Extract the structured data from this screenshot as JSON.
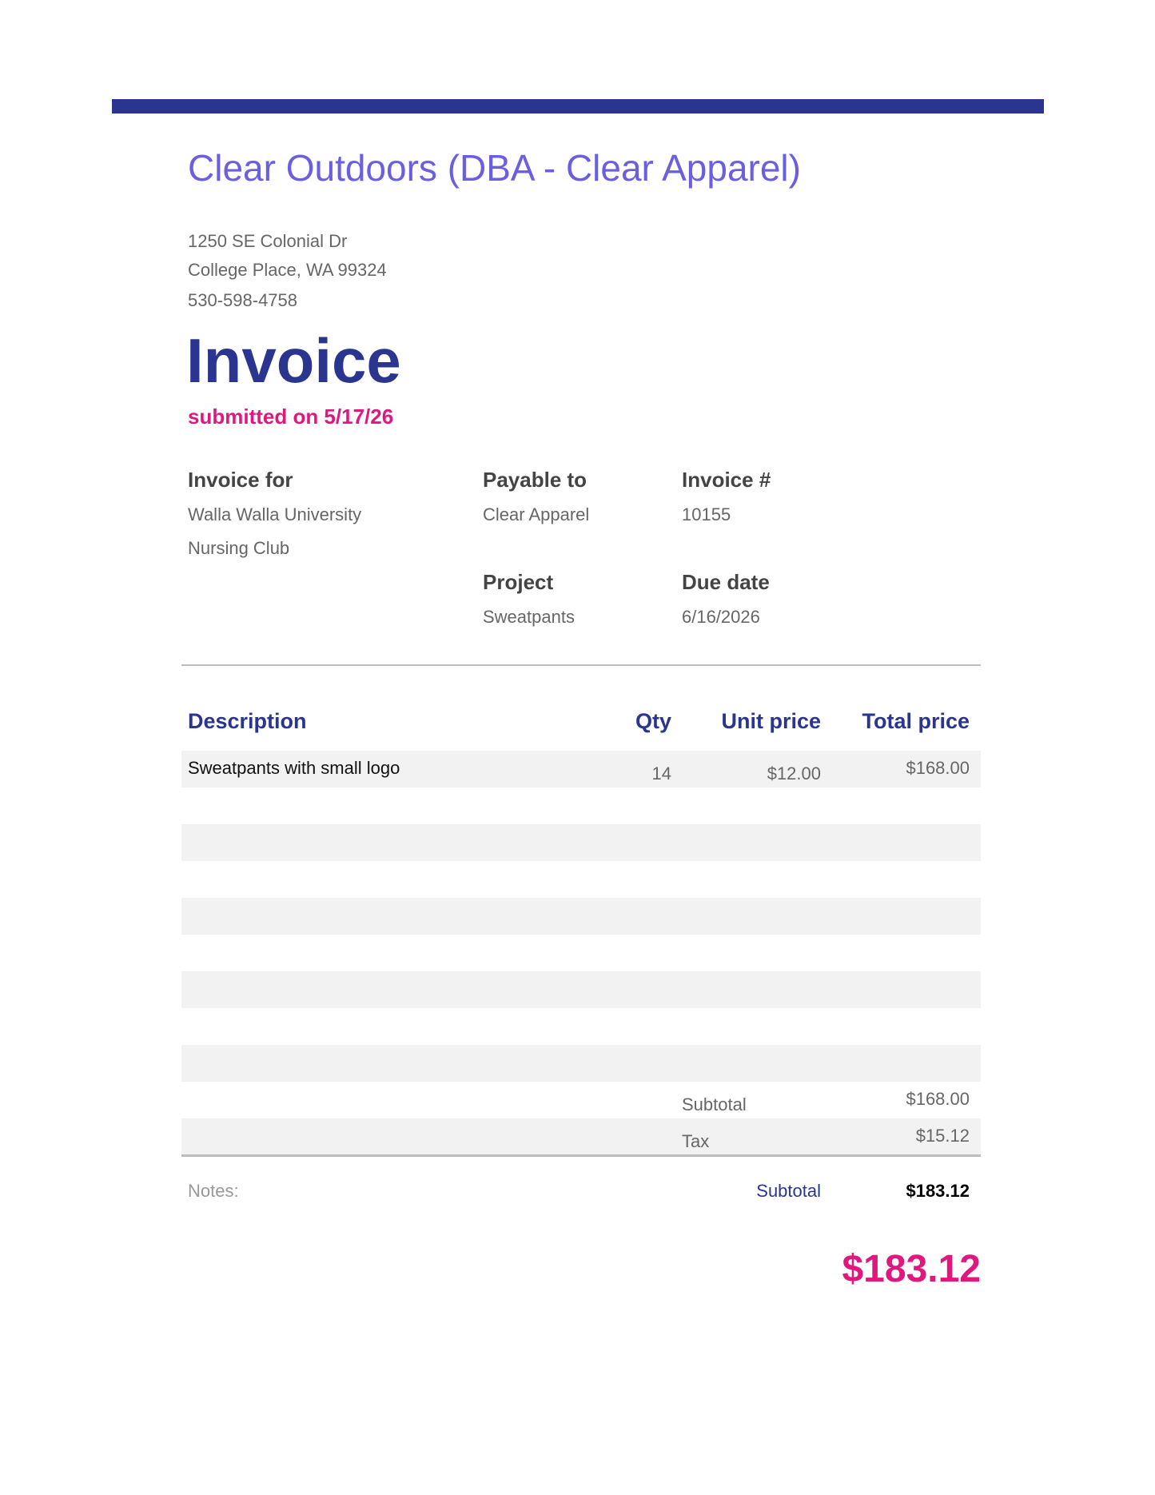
{
  "header": {
    "company_name": "Clear Outdoors (DBA - Clear Apparel)",
    "address_line1": "1250 SE Colonial Dr",
    "address_line2": "College Place, WA 99324",
    "phone": "530-598-4758",
    "accent_color": "#2a3590"
  },
  "title": {
    "heading": "Invoice",
    "submitted": "submitted on 5/17/26"
  },
  "info": {
    "invoice_for_label": "Invoice for",
    "invoice_for_line1": "Walla Walla University",
    "invoice_for_line2": "Nursing Club",
    "payable_to_label": "Payable to",
    "payable_to_value": "Clear Apparel",
    "invoice_no_label": "Invoice #",
    "invoice_no_value": "10155",
    "project_label": "Project",
    "project_value": "Sweatpants",
    "due_date_label": "Due date",
    "due_date_value": "6/16/2026"
  },
  "table": {
    "headers": {
      "description": "Description",
      "qty": "Qty",
      "unit_price": "Unit price",
      "total_price": "Total price"
    },
    "rows": [
      {
        "description": "Sweatpants with small logo",
        "qty": "14",
        "unit_price": "$12.00",
        "total_price": "$168.00"
      }
    ]
  },
  "totals": {
    "subtotal_label": "Subtotal",
    "subtotal_value": "$168.00",
    "tax_label": "Tax",
    "tax_value": "$15.12",
    "final_label": "Subtotal",
    "final_value": "$183.12",
    "grand_total": "$183.12"
  },
  "notes": {
    "label": "Notes:"
  }
}
